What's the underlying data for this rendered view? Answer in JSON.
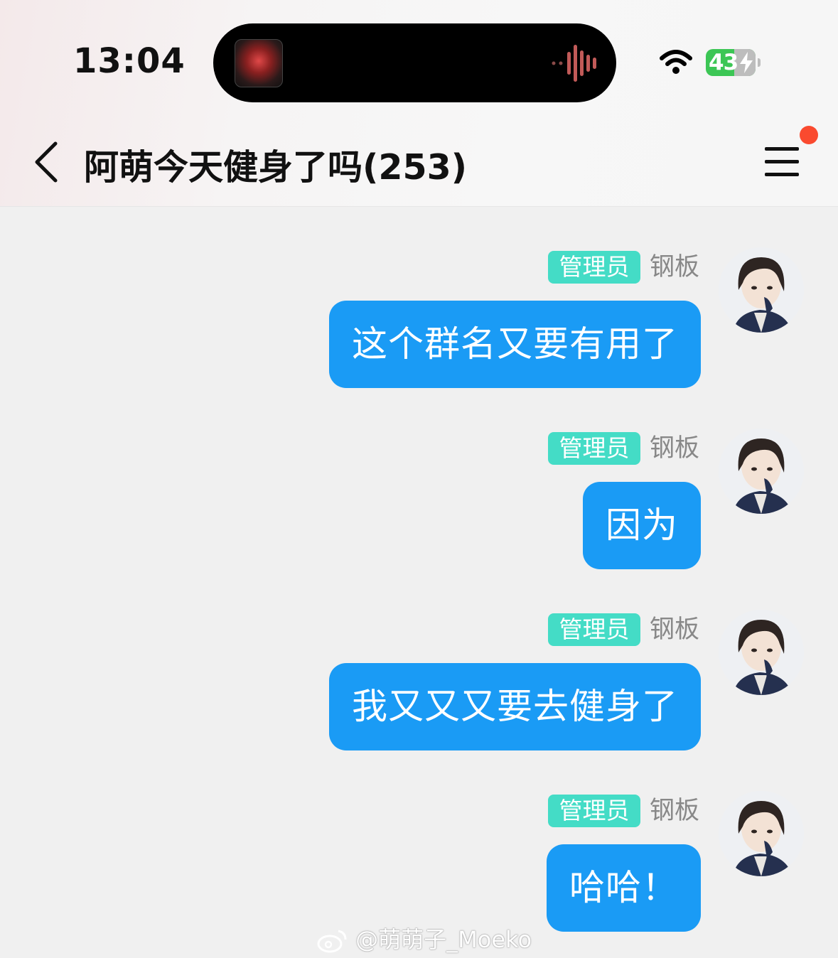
{
  "status_bar": {
    "time": "13:04",
    "battery": "43"
  },
  "header": {
    "back_icon": "chevron-left-icon",
    "title": "阿萌今天健身了吗(253)",
    "menu_icon": "hamburger-menu-icon"
  },
  "messages": [
    {
      "badge": "管理员",
      "sender": "钢板",
      "text": "这个群名又要有用了"
    },
    {
      "badge": "管理员",
      "sender": "钢板",
      "text": "因为"
    },
    {
      "badge": "管理员",
      "sender": "钢板",
      "text": "我又又又要去健身了"
    },
    {
      "badge": "管理员",
      "sender": "钢板",
      "text": "哈哈！"
    }
  ],
  "watermark": "@萌萌子_Moeko",
  "colors": {
    "bubble": "#1a9bf5",
    "badge": "#44dcc6",
    "notify_dot": "#fa4a2f",
    "battery": "#3cc655"
  }
}
